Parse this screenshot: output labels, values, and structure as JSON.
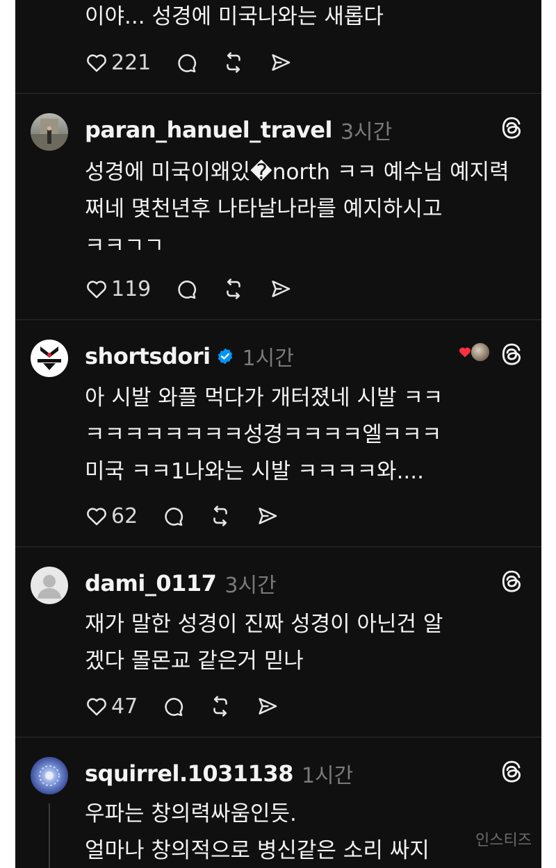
{
  "posts": [
    {
      "text": "이야... 성경에 미국나와는 새롭다",
      "likes": "221"
    },
    {
      "username": "paran_hanuel_travel",
      "time": "3시간",
      "text": "성경에 미국이왜있�north ㅋㅋ 예수님 예지력\n쩌네 몇천년후 나타날나라를 예지하시고\nㅋㅋㄱㄱ",
      "likes": "119"
    },
    {
      "username": "shortsdori",
      "time": "1시간",
      "text": "아 시발 와플 먹다가 개터졌네 시발 ㅋㅋ\nㅋㅋㅋㅋㅋㅋㅋㅋ성경ㅋㅋㅋㅋ엘ㅋㅋㅋ\n미국 ㅋㅋ1나와는 시발 ㅋㅋㅋㅋ와....",
      "likes": "62"
    },
    {
      "username": "dami_0117",
      "time": "3시간",
      "text": "재가 말한 성경이 진짜 성경이 아닌건 알\n겠다 몰몬교 같은거 믿나",
      "likes": "47"
    },
    {
      "username": "squirrel.1031138",
      "time": "1시간",
      "text": "우파는 창의력싸움인듯.\n얼마나 창의적으로 병신같은 소리 싸지"
    }
  ],
  "watermark": "인스티즈",
  "colors": {
    "background": "#101010",
    "text": "#f3f3f3",
    "muted": "#7a7a7a",
    "divider": "#2e2e2e",
    "verified": "#0095f6",
    "heart": "#ff3040"
  }
}
